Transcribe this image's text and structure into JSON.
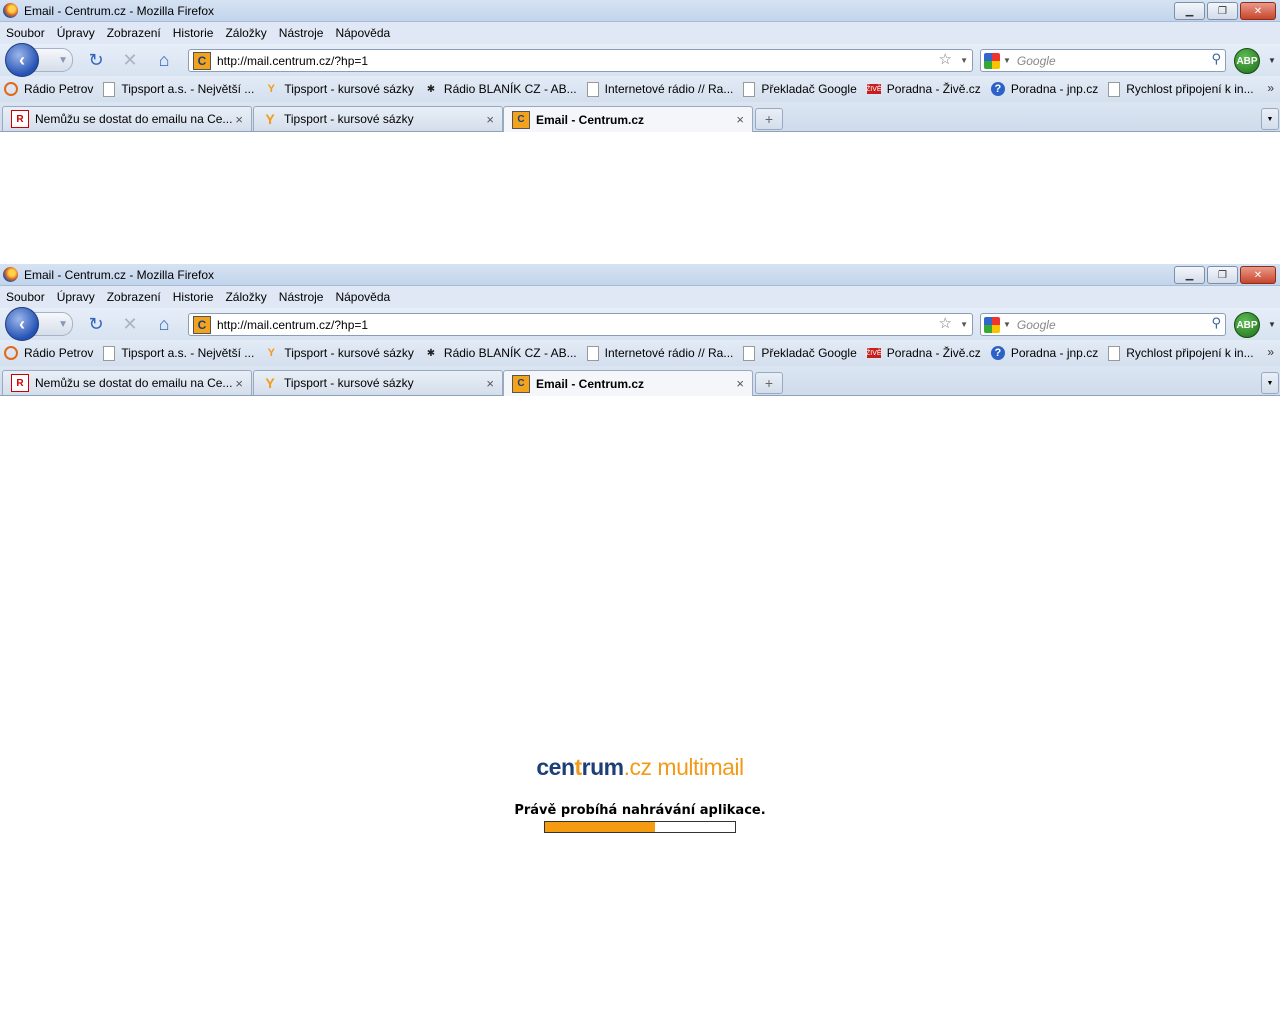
{
  "window": {
    "title": "Email - Centrum.cz - Mozilla Firefox",
    "controls": {
      "minimize": "▁",
      "maximize": "❐",
      "close": "✕"
    }
  },
  "menu": [
    "Soubor",
    "Úpravy",
    "Zobrazení",
    "Historie",
    "Záložky",
    "Nástroje",
    "Nápověda"
  ],
  "nav": {
    "back_icon": "‹",
    "forward_icon": "›",
    "reload_icon": "↻",
    "stop_icon": "✕",
    "home_icon": "⌂",
    "site_icon_letter": "C",
    "url": "http://mail.centrum.cz/?hp=1",
    "bookmark_star": "☆",
    "search_placeholder": "Google",
    "search_icon": "⚲",
    "addon_label": "ABP"
  },
  "bookmarks": [
    {
      "label": "Rádio Petrov",
      "icon": "radio"
    },
    {
      "label": "Tipsport a.s. - Největší ...",
      "icon": "page"
    },
    {
      "label": "Tipsport - kursové sázky",
      "icon": "tipsport"
    },
    {
      "label": "Rádio BLANÍK CZ - AB...",
      "icon": "blanik"
    },
    {
      "label": "Internetové rádio // Ra...",
      "icon": "page"
    },
    {
      "label": "Překladač Google",
      "icon": "page"
    },
    {
      "label": "Poradna - Živě.cz",
      "icon": "zive"
    },
    {
      "label": "Poradna - jnp.cz",
      "icon": "help"
    },
    {
      "label": "Rychlost připojení k in...",
      "icon": "page"
    }
  ],
  "bookmark_more": "»",
  "tabs": [
    {
      "label": "Nemůžu se dostat do emailu na Ce...",
      "icon": "net",
      "active": false
    },
    {
      "label": "Tipsport - kursové sázky",
      "icon": "tipsport",
      "active": false
    },
    {
      "label": "Email - Centrum.cz",
      "icon": "centrum",
      "active": true
    }
  ],
  "newtab_icon": "+",
  "tab_close": "×",
  "page": {
    "logo_part1": "cen",
    "logo_part2": "t",
    "logo_part3": "rum",
    "logo_suffix": ".cz multimail",
    "loading_text": "Právě probíhá nahrávání aplikace.",
    "progress_fraction": 0.58
  },
  "colors": {
    "accent_orange": "#f49b12",
    "logo_blue": "#1c3f77"
  }
}
